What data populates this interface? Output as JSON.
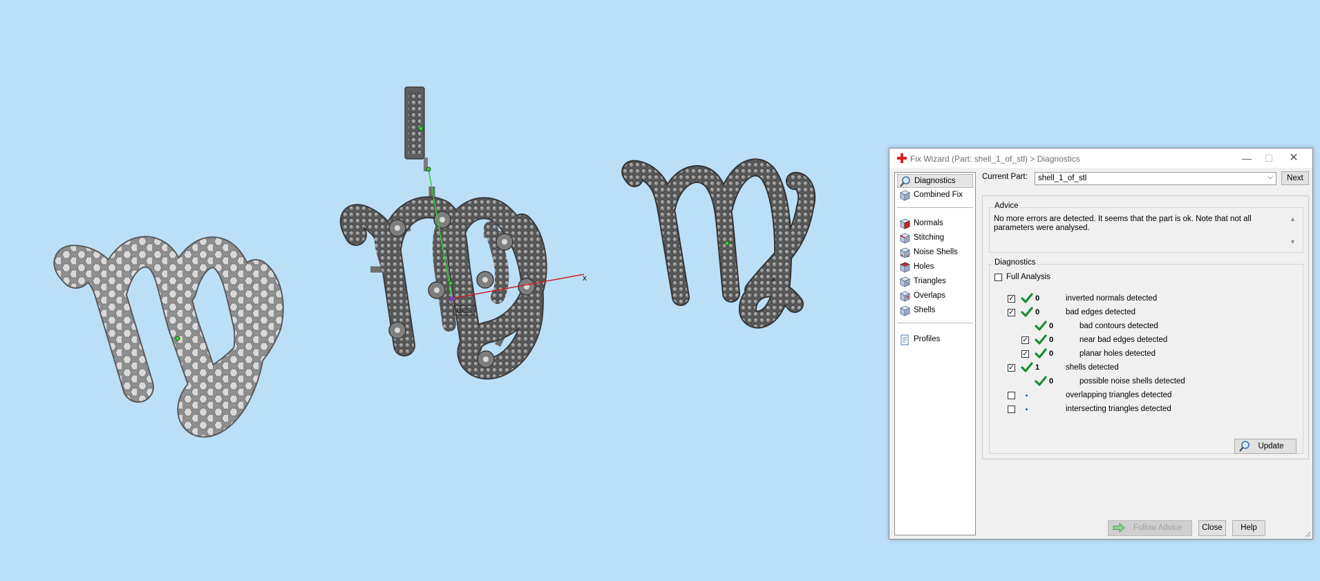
{
  "viewport": {
    "axis_x_label": "x",
    "ucs_label": "UCS"
  },
  "dialog": {
    "title": "Fix Wizard (Part: shell_1_of_stl) > Diagnostics",
    "window_controls": {
      "minimize": "—",
      "maximize": "☐",
      "close": "✕"
    },
    "nav": {
      "group1": [
        {
          "label": "Diagnostics",
          "icon": "magnifier-icon",
          "selected": true
        },
        {
          "label": "Combined Fix",
          "icon": "cube-icon"
        }
      ],
      "group2": [
        {
          "label": "Normals",
          "icon": "normals-cube-icon"
        },
        {
          "label": "Stitching",
          "icon": "stitching-cube-icon"
        },
        {
          "label": "Noise Shells",
          "icon": "noise-shells-icon"
        },
        {
          "label": "Holes",
          "icon": "holes-cube-icon"
        },
        {
          "label": "Triangles",
          "icon": "triangles-cube-icon"
        },
        {
          "label": "Overlaps",
          "icon": "overlaps-cube-icon"
        },
        {
          "label": "Shells",
          "icon": "shells-cube-icon"
        }
      ],
      "group3": [
        {
          "label": "Profiles",
          "icon": "profiles-document-icon"
        }
      ]
    },
    "current_part": {
      "label": "Current Part:",
      "value": "shell_1_of_stl",
      "next_button": "Next"
    },
    "advice": {
      "group_label": "Advice",
      "text": "No more errors are detected. It seems that the part is ok. Note that not all parameters were analysed."
    },
    "diagnostics": {
      "group_label": "Diagnostics",
      "full_analysis": {
        "label": "Full Analysis",
        "checked": false
      },
      "rows": [
        {
          "checkbox": true,
          "checked": true,
          "status": "ok",
          "count": "0",
          "label": "inverted normals detected",
          "indent": 0
        },
        {
          "checkbox": true,
          "checked": true,
          "status": "ok",
          "count": "0",
          "label": "bad edges detected",
          "indent": 0
        },
        {
          "checkbox": false,
          "status": "ok",
          "count": "0",
          "label": "bad contours detected",
          "indent": 1
        },
        {
          "checkbox": true,
          "checked": true,
          "status": "ok",
          "count": "0",
          "label": "near bad edges detected",
          "indent": 1
        },
        {
          "checkbox": true,
          "checked": true,
          "status": "ok",
          "count": "0",
          "label": "planar holes detected",
          "indent": 1
        },
        {
          "checkbox": true,
          "checked": true,
          "status": "ok",
          "count": "1",
          "label": "shells detected",
          "indent": 0
        },
        {
          "checkbox": false,
          "status": "ok",
          "count": "0",
          "label": "possible noise shells detected",
          "indent": 1
        },
        {
          "checkbox": true,
          "checked": false,
          "status": "pending",
          "count": "",
          "label": "overlapping triangles detected",
          "indent": 0
        },
        {
          "checkbox": true,
          "checked": false,
          "status": "pending",
          "count": "",
          "label": "intersecting triangles detected",
          "indent": 0
        }
      ],
      "update_button": "Update"
    },
    "footer": {
      "follow_advice": "Follow Advice",
      "close": "Close",
      "help": "Help"
    }
  }
}
